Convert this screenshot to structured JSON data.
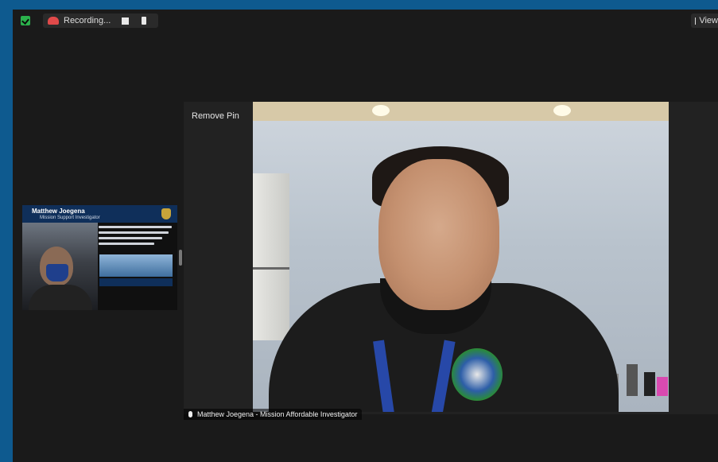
{
  "toolbar": {
    "recording_label": "Recording...",
    "view_label": "View"
  },
  "thumbnail": {
    "name": "Matthew Joegena",
    "subtitle": "Mission Support Investigator"
  },
  "main_video": {
    "pin_label": "Remove Pin",
    "participant_name": "Matthew Joegena - Mission Affordable Investigator"
  },
  "colors": {
    "frame": "#0e5a8f",
    "background": "#1a1a1a",
    "encryption": "#2bb24c",
    "recording": "#e04a4a"
  },
  "icons": [
    "shield-check-icon",
    "recording-icon",
    "pause-icon",
    "stop-icon",
    "view-icon",
    "microphone-icon"
  ]
}
